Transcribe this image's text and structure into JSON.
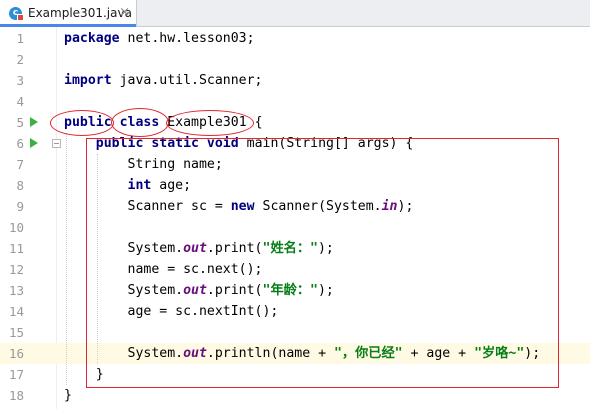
{
  "tab": {
    "file_name": "Example301.java",
    "icon_letter": "c",
    "close_symbol": "×"
  },
  "gutter": {
    "current_line": 16,
    "run_lines": [
      5,
      6
    ],
    "fold_lines": [
      6
    ]
  },
  "code": {
    "line1": [
      [
        "kw",
        "package"
      ],
      [
        "p",
        " net.hw.lesson03;"
      ]
    ],
    "line2": [],
    "line3": [
      [
        "kw",
        "import"
      ],
      [
        "p",
        " java.util.Scanner;"
      ]
    ],
    "line4": [],
    "line5": [
      [
        "kw",
        "public"
      ],
      [
        "p",
        " "
      ],
      [
        "kw",
        "class"
      ],
      [
        "p",
        " Example301 {"
      ]
    ],
    "line6": [
      [
        "p",
        "    "
      ],
      [
        "kw",
        "public static void"
      ],
      [
        "p",
        " main(String[] args) {"
      ]
    ],
    "line7": [
      [
        "p",
        "        String name;"
      ]
    ],
    "line8": [
      [
        "p",
        "        "
      ],
      [
        "kw",
        "int"
      ],
      [
        "p",
        " age;"
      ]
    ],
    "line9": [
      [
        "p",
        "        Scanner sc = "
      ],
      [
        "kw",
        "new"
      ],
      [
        "p",
        " Scanner(System."
      ],
      [
        "fd",
        "in"
      ],
      [
        "p",
        ");"
      ]
    ],
    "line10": [],
    "line11": [
      [
        "p",
        "        System."
      ],
      [
        "fd",
        "out"
      ],
      [
        "p",
        ".print("
      ],
      [
        "st",
        "\"姓名：\""
      ],
      [
        "p",
        ");"
      ]
    ],
    "line12": [
      [
        "p",
        "        name = sc.next();"
      ]
    ],
    "line13": [
      [
        "p",
        "        System."
      ],
      [
        "fd",
        "out"
      ],
      [
        "p",
        ".print("
      ],
      [
        "st",
        "\"年龄：\""
      ],
      [
        "p",
        ");"
      ]
    ],
    "line14": [
      [
        "p",
        "        age = sc.nextInt();"
      ]
    ],
    "line15": [],
    "line16": [
      [
        "p",
        "        System."
      ],
      [
        "fd",
        "out"
      ],
      [
        "p",
        ".println(name + "
      ],
      [
        "st",
        "\"，你已经\""
      ],
      [
        "p",
        " + age + "
      ],
      [
        "st",
        "\"岁咯~\""
      ],
      [
        "p",
        ");"
      ]
    ],
    "line17": [
      [
        "p",
        "    }"
      ]
    ],
    "line18": [
      [
        "p",
        "}"
      ]
    ]
  },
  "colors": {
    "accent": "#4a86e8",
    "annotation": "#e0262f",
    "current_line": "#fffae3",
    "keyword": "#000080",
    "string": "#067d17",
    "field": "#660e7a"
  }
}
